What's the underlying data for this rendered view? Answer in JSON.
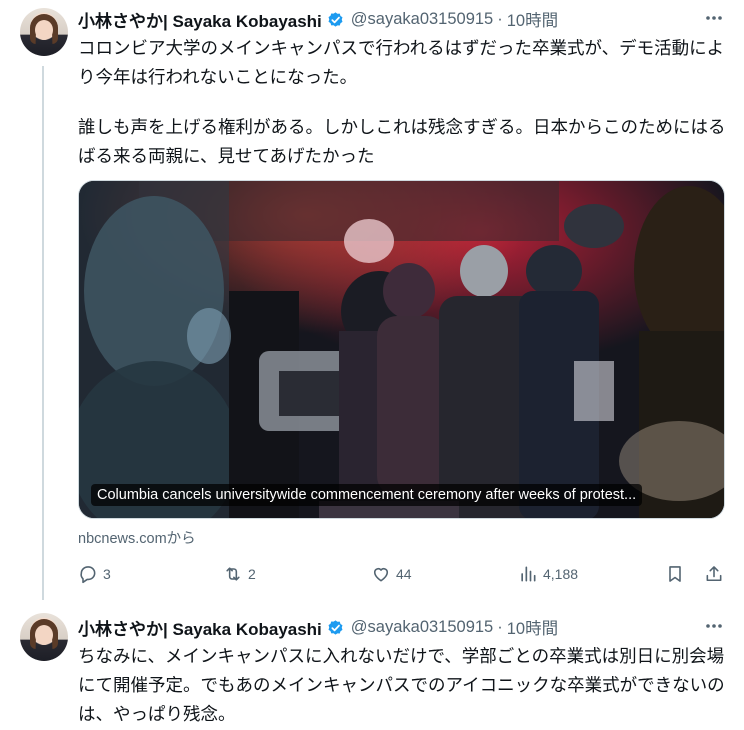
{
  "tweets": [
    {
      "author_name": "小林さやか| Sayaka Kobayashi",
      "handle": "@sayaka03150915",
      "separator": "·",
      "time": "10時間",
      "text_p1": "コロンビア大学のメインキャンパスで行われるはずだった卒業式が、デモ活動により今年は行われないことになった。",
      "text_p2": "誰しも声を上げる権利がある。しかしこれは残念すぎる。日本からこのためにはるばる来る両親に、見せてあげたかった",
      "card": {
        "caption": "Columbia cancels universitywide commencement ceremony after weeks of protest...",
        "source": "nbcnews.comから"
      },
      "actions": {
        "replies": "3",
        "reposts": "2",
        "likes": "44",
        "views": "4,188"
      }
    },
    {
      "author_name": "小林さやか| Sayaka Kobayashi",
      "handle": "@sayaka03150915",
      "separator": "·",
      "time": "10時間",
      "text_p1": "ちなみに、メインキャンパスに入れないだけで、学部ごとの卒業式は別日に別会場にて開催予定。でもあのメインキャンパスでのアイコニックな卒業式ができないのは、やっぱり残念。"
    }
  ],
  "colors": {
    "verified_blue": "#1d9bf0",
    "secondary_text": "#536471",
    "primary_text": "#0f1419"
  },
  "icons": {
    "verified": "verified-badge-icon",
    "more": "more-dots-icon",
    "reply": "reply-icon",
    "repost": "repost-icon",
    "like": "heart-icon",
    "views": "views-bar-icon",
    "bookmark": "bookmark-icon",
    "share": "share-icon"
  }
}
